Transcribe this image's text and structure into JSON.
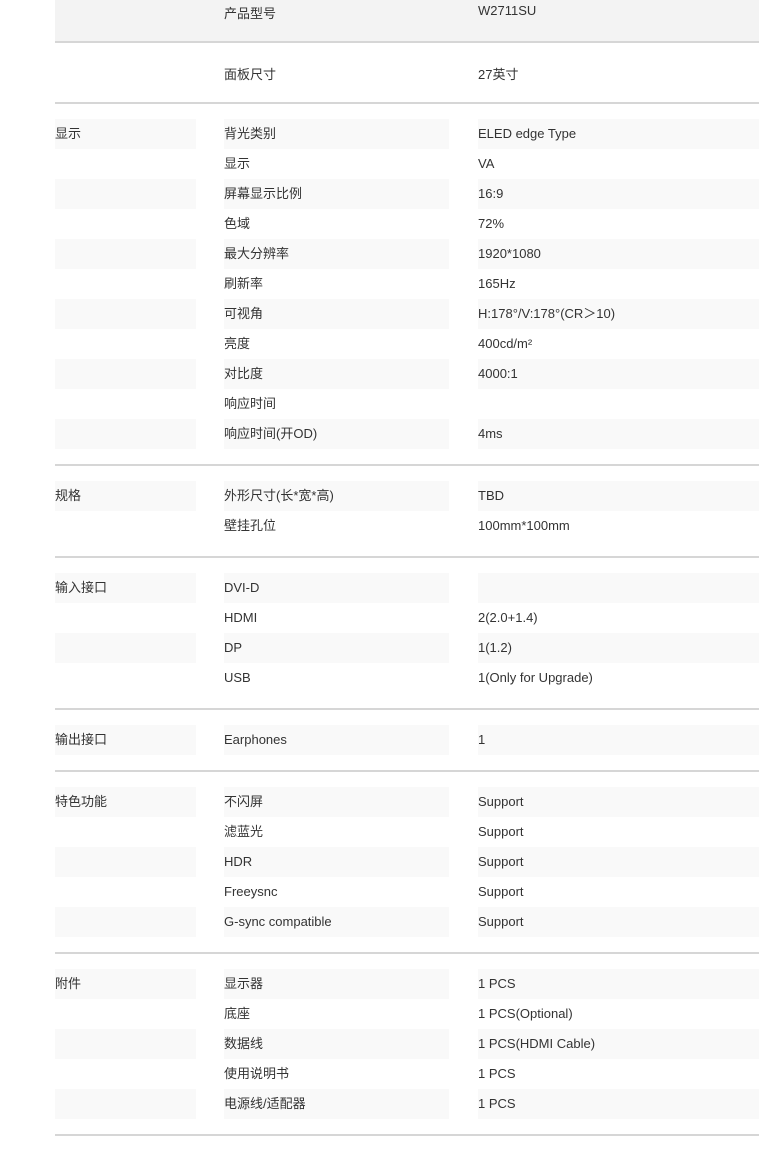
{
  "header_rows": [
    {
      "label": "产品型号",
      "value": "W2711SU"
    },
    {
      "label": "面板尺寸",
      "value": "27英寸"
    }
  ],
  "groups": [
    {
      "title": "显示",
      "rows": [
        {
          "label": "背光类别",
          "value": "ELED edge Type"
        },
        {
          "label": "显示",
          "value": "VA"
        },
        {
          "label": "屏幕显示比例",
          "value": "16:9"
        },
        {
          "label": "色域",
          "value": "72%"
        },
        {
          "label": "最大分辨率",
          "value": "1920*1080"
        },
        {
          "label": "刷新率",
          "value": "165Hz"
        },
        {
          "label": "可视角",
          "value": "H:178°/V:178°(CR＞10)"
        },
        {
          "label": "亮度",
          "value": "400cd/m²"
        },
        {
          "label": "对比度",
          "value": "4000:1"
        },
        {
          "label": "响应时间",
          "value": ""
        },
        {
          "label": "响应时间(开OD)",
          "value": "4ms"
        }
      ]
    },
    {
      "title": "规格",
      "rows": [
        {
          "label": "外形尺寸(长*宽*高)",
          "value": "TBD"
        },
        {
          "label": "壁挂孔位",
          "value": "100mm*100mm"
        }
      ]
    },
    {
      "title": "输入接口",
      "rows": [
        {
          "label": "DVI-D",
          "value": ""
        },
        {
          "label": "HDMI",
          "value": "2(2.0+1.4)"
        },
        {
          "label": "DP",
          "value": "1(1.2)"
        },
        {
          "label": "USB",
          "value": "1(Only for Upgrade)"
        }
      ]
    },
    {
      "title": "输出接口",
      "rows": [
        {
          "label": "Earphones",
          "value": "1"
        }
      ]
    },
    {
      "title": "特色功能",
      "rows": [
        {
          "label": "不闪屏",
          "value": "Support"
        },
        {
          "label": "滤蓝光",
          "value": "Support"
        },
        {
          "label": "HDR",
          "value": "Support"
        },
        {
          "label": "Freeysnc",
          "value": "Support"
        },
        {
          "label": "G-sync compatible",
          "value": "Support"
        }
      ]
    },
    {
      "title": "附件",
      "rows": [
        {
          "label": "显示器",
          "value": "1 PCS"
        },
        {
          "label": "底座",
          "value": "1 PCS(Optional)"
        },
        {
          "label": "数据线",
          "value": "1 PCS(HDMI Cable)"
        },
        {
          "label": "使用说明书",
          "value": "1 PCS"
        },
        {
          "label": "电源线/适配器",
          "value": "1 PCS"
        }
      ]
    }
  ]
}
